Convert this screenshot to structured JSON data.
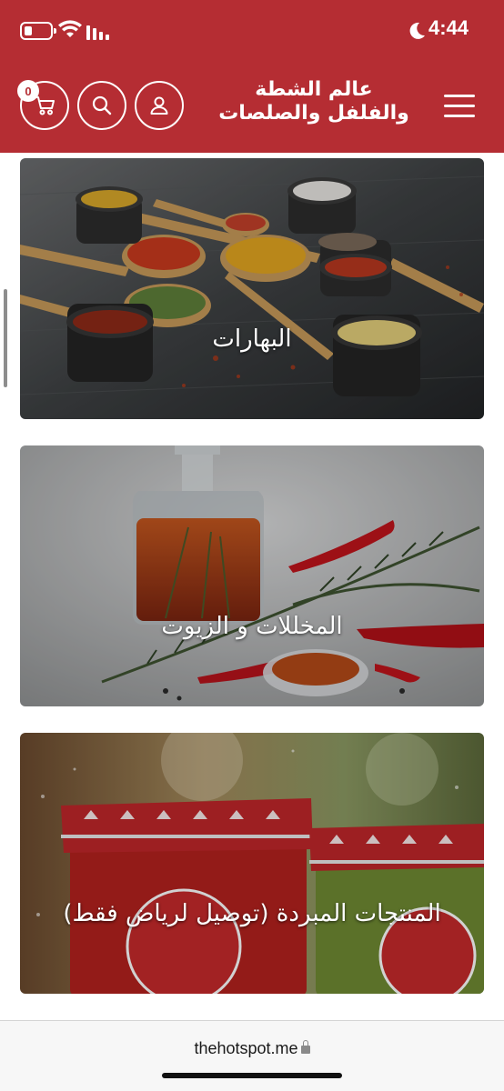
{
  "status_bar": {
    "time": "4:44",
    "icons": [
      "battery-icon",
      "wifi-icon",
      "signal-icon",
      "moon-icon"
    ]
  },
  "header": {
    "logo_line1": "عالم الشطة",
    "logo_line2": "والفلفل والصلصات",
    "cart_count": "0",
    "icons": [
      "cart-icon",
      "search-icon",
      "user-icon",
      "menu-icon"
    ]
  },
  "categories": [
    {
      "label": "البهارات"
    },
    {
      "label": "المخللات و الزيوت"
    },
    {
      "label": "المنتجات المبردة (توصيل لرياض فقط)"
    }
  ],
  "browser": {
    "url": "thehotspot.me"
  },
  "colors": {
    "brand_red": "#b52d33",
    "white": "#ffffff"
  }
}
